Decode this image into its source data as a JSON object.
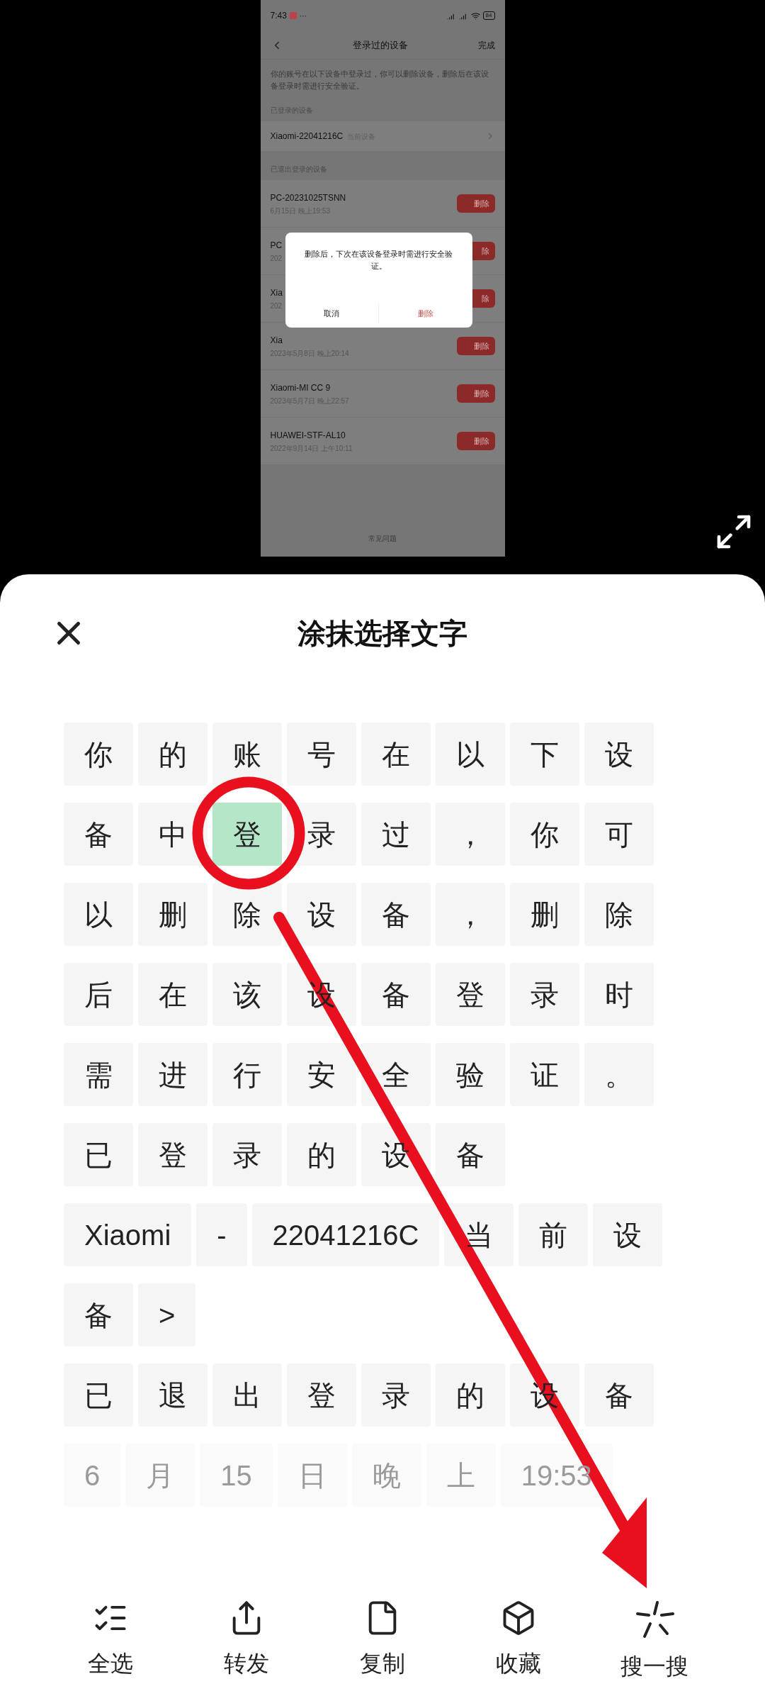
{
  "video_frame": {
    "status_bar": {
      "time": "7:43",
      "more": "···",
      "battery": "84"
    },
    "nav": {
      "title": "登录过的设备",
      "action": "完成"
    },
    "description": "你的账号在以下设备中登录过，你可以删除设备，删除后在该设备登录时需进行安全验证。",
    "logged_in_section": "已登录的设备",
    "current_device": {
      "name": "Xiaomi-22041216C",
      "tag": "当前设备"
    },
    "logged_out_section": "已退出登录的设备",
    "devices": [
      {
        "name": "PC-20231025TSNN",
        "date": "6月15日 晚上19:53",
        "button": "删除"
      },
      {
        "name": "PC",
        "date": "202",
        "button": "除"
      },
      {
        "name": "Xia",
        "date": "202",
        "button": "除"
      },
      {
        "name": "Xia",
        "date": "2023年5月8日 晚上20:14",
        "button": "删除"
      },
      {
        "name": "Xiaomi-MI CC 9",
        "date": "2023年5月7日 晚上22:57",
        "button": "删除"
      },
      {
        "name": "HUAWEI-STF-AL10",
        "date": "2022年9月14日 上午10:11",
        "button": "删除"
      }
    ],
    "faq": "常见问题",
    "dialog": {
      "message": "删除后，下次在该设备登录时需进行安全验证。",
      "cancel": "取消",
      "confirm": "删除"
    }
  },
  "sheet": {
    "title": "涂抹选择文字",
    "rows": [
      {
        "faded": false,
        "chips": [
          {
            "text": "你",
            "selected": false
          },
          {
            "text": "的",
            "selected": false
          },
          {
            "text": "账",
            "selected": false
          },
          {
            "text": "号",
            "selected": false
          },
          {
            "text": "在",
            "selected": false
          },
          {
            "text": "以",
            "selected": false
          },
          {
            "text": "下",
            "selected": false
          },
          {
            "text": "设",
            "selected": false
          }
        ]
      },
      {
        "faded": false,
        "chips": [
          {
            "text": "备",
            "selected": false
          },
          {
            "text": "中",
            "selected": false
          },
          {
            "text": "登",
            "selected": true
          },
          {
            "text": "录",
            "selected": false
          },
          {
            "text": "过",
            "selected": false
          },
          {
            "text": "，",
            "selected": false
          },
          {
            "text": "你",
            "selected": false
          },
          {
            "text": "可",
            "selected": false
          }
        ]
      },
      {
        "faded": false,
        "chips": [
          {
            "text": "以",
            "selected": false
          },
          {
            "text": "删",
            "selected": false
          },
          {
            "text": "除",
            "selected": false
          },
          {
            "text": "设",
            "selected": false
          },
          {
            "text": "备",
            "selected": false
          },
          {
            "text": "，",
            "selected": false
          },
          {
            "text": "删",
            "selected": false
          },
          {
            "text": "除",
            "selected": false
          }
        ]
      },
      {
        "faded": false,
        "chips": [
          {
            "text": "后",
            "selected": false
          },
          {
            "text": "在",
            "selected": false
          },
          {
            "text": "该",
            "selected": false
          },
          {
            "text": "设",
            "selected": false
          },
          {
            "text": "备",
            "selected": false
          },
          {
            "text": "登",
            "selected": false
          },
          {
            "text": "录",
            "selected": false
          },
          {
            "text": "时",
            "selected": false
          }
        ]
      },
      {
        "faded": false,
        "chips": [
          {
            "text": "需",
            "selected": false
          },
          {
            "text": "进",
            "selected": false
          },
          {
            "text": "行",
            "selected": false
          },
          {
            "text": "安",
            "selected": false
          },
          {
            "text": "全",
            "selected": false
          },
          {
            "text": "验",
            "selected": false
          },
          {
            "text": "证",
            "selected": false
          },
          {
            "text": "。",
            "selected": false
          }
        ]
      },
      {
        "faded": false,
        "chips": [
          {
            "text": "已",
            "selected": false
          },
          {
            "text": "登",
            "selected": false
          },
          {
            "text": "录",
            "selected": false
          },
          {
            "text": "的",
            "selected": false
          },
          {
            "text": "设",
            "selected": false
          },
          {
            "text": "备",
            "selected": false
          }
        ]
      },
      {
        "faded": false,
        "chips": [
          {
            "text": "Xiaomi",
            "selected": false
          },
          {
            "text": "-",
            "selected": false
          },
          {
            "text": "22041216C",
            "selected": false
          },
          {
            "text": "当",
            "selected": false
          },
          {
            "text": "前",
            "selected": false
          },
          {
            "text": "设",
            "selected": false
          }
        ]
      },
      {
        "faded": false,
        "chips": [
          {
            "text": "备",
            "selected": false
          },
          {
            "text": ">",
            "selected": false
          }
        ]
      },
      {
        "faded": false,
        "chips": [
          {
            "text": "已",
            "selected": false
          },
          {
            "text": "退",
            "selected": false
          },
          {
            "text": "出",
            "selected": false
          },
          {
            "text": "登",
            "selected": false
          },
          {
            "text": "录",
            "selected": false
          },
          {
            "text": "的",
            "selected": false
          },
          {
            "text": "设",
            "selected": false
          },
          {
            "text": "备",
            "selected": false
          }
        ]
      },
      {
        "faded": true,
        "chips": [
          {
            "text": "6",
            "selected": false
          },
          {
            "text": "月",
            "selected": false
          },
          {
            "text": "15",
            "selected": false
          },
          {
            "text": "日",
            "selected": false
          },
          {
            "text": "晚",
            "selected": false
          },
          {
            "text": "上",
            "selected": false
          },
          {
            "text": "19:53",
            "selected": false
          }
        ]
      }
    ],
    "toolbar": [
      {
        "kind": "select-all",
        "label": "全选"
      },
      {
        "kind": "share",
        "label": "转发"
      },
      {
        "kind": "copy",
        "label": "复制"
      },
      {
        "kind": "favorite",
        "label": "收藏"
      },
      {
        "kind": "search",
        "label": "搜一搜"
      }
    ]
  }
}
